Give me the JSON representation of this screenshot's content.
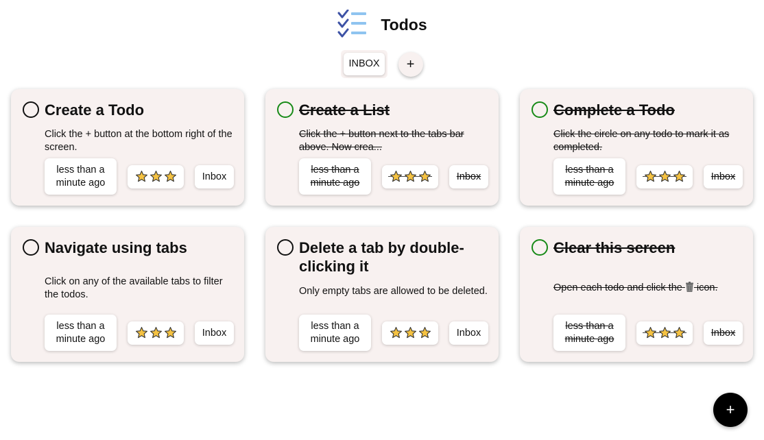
{
  "app": {
    "title": "Todos",
    "logo_icon": "checklist-icon"
  },
  "tabs": {
    "items": [
      {
        "label": "INBOX"
      }
    ],
    "add_label": "+"
  },
  "todos": [
    {
      "title": "Create a Todo",
      "description": "Click the + button at the bottom right of the screen.",
      "time": "less than a minute ago",
      "tag": "Inbox",
      "completed": false,
      "stars": 3
    },
    {
      "title": "Create a List",
      "description": "Click the + button next to the tabs bar above. Now crea...",
      "time": "less than a minute ago",
      "tag": "Inbox",
      "completed": true,
      "stars": 3
    },
    {
      "title": "Complete a Todo",
      "description": "Click the circle on any todo to mark it as completed.",
      "time": "less than a minute ago",
      "tag": "Inbox",
      "completed": true,
      "stars": 3
    },
    {
      "title": "Navigate using tabs",
      "description": "Click on any of the available tabs to filter the todos.",
      "time": "less than a minute ago",
      "tag": "Inbox",
      "completed": false,
      "stars": 3
    },
    {
      "title": "Delete a tab by double-clicking it",
      "description": "Only empty tabs are allowed to be deleted.",
      "time": "less than a minute ago",
      "tag": "Inbox",
      "completed": false,
      "stars": 3
    },
    {
      "title": "Clear this screen",
      "description_before": "Open each todo and click the",
      "description_icon": "trash-icon",
      "description_after": "icon.",
      "time": "less than a minute ago",
      "tag": "Inbox",
      "completed": true,
      "stars": 3
    }
  ],
  "fab": {
    "label": "+"
  },
  "colors": {
    "card_bg": "#f8f1f0",
    "complete_green": "#178a17",
    "star_fill": "#f5c242",
    "star_stroke": "#333333"
  }
}
